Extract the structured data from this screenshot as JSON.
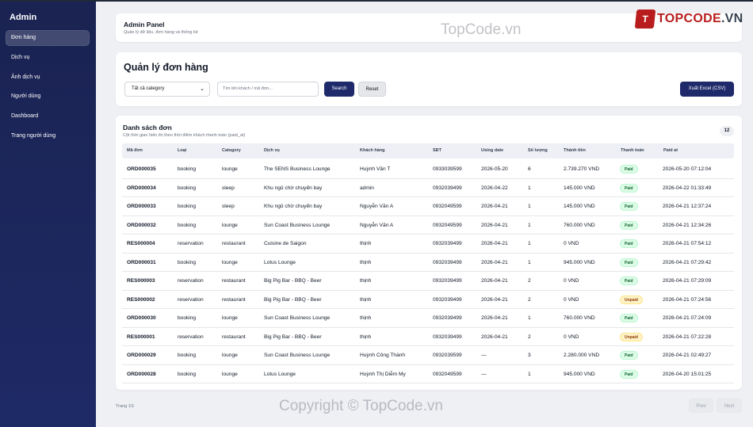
{
  "sidebar": {
    "brand": "Admin",
    "items": [
      {
        "label": "Đơn hàng",
        "active": true
      },
      {
        "label": "Dịch vụ"
      },
      {
        "label": "Ảnh dịch vụ"
      },
      {
        "label": "Người dùng"
      },
      {
        "label": "Dashboard"
      },
      {
        "label": "Trang người dùng"
      }
    ]
  },
  "header": {
    "title": "Admin Panel",
    "subtitle": "Quản lý dữ liệu, đơn hàng và thống kê",
    "logo_mark": "T",
    "logo_text_red": "TOPCODE",
    "logo_text_gray": ".VN"
  },
  "watermarks": {
    "top": "TopCode.vn",
    "bottom": "Copyright © TopCode.vn"
  },
  "filters": {
    "title": "Quản lý đơn hàng",
    "category_selected": "Tất cả category",
    "search_placeholder": "Tìm tên khách / mã đơn...",
    "search_label": "Search",
    "reset_label": "Reset",
    "export_label": "Xuất Excel (CSV)"
  },
  "list": {
    "title": "Danh sách đơn",
    "subtitle": "Cột thời gian hiển thị theo thời điểm khách thanh toán (paid_at)",
    "count": "12",
    "columns": [
      "Mã đơn",
      "Loại",
      "Category",
      "Dịch vụ",
      "Khách hàng",
      "SĐT",
      "Using date",
      "Số lượng",
      "Thành tiền",
      "Thanh toán",
      "Paid at"
    ],
    "rows": [
      {
        "id": "ORD000035",
        "type": "booking",
        "cat": "lounge",
        "svc": "The SENS Business Lounge",
        "cust": "Huỳnh Văn T",
        "phone": "0933039599",
        "date": "2026-05-20",
        "qty": "6",
        "total": "2.739.270 VND",
        "status": "Paid",
        "paid_at": "2026-05-20 07:12:04"
      },
      {
        "id": "ORD000034",
        "type": "booking",
        "cat": "sleep",
        "svc": "Khu ngủ chờ chuyến bay",
        "cust": "admin",
        "phone": "0932039499",
        "date": "2026-04-22",
        "qty": "1",
        "total": "145.000 VND",
        "status": "Paid",
        "paid_at": "2026-04-22 01:33:49"
      },
      {
        "id": "ORD000033",
        "type": "booking",
        "cat": "sleep",
        "svc": "Khu ngủ chờ chuyến bay",
        "cust": "Nguyễn Văn A",
        "phone": "0932049599",
        "date": "2026-04-21",
        "qty": "1",
        "total": "145.000 VND",
        "status": "Paid",
        "paid_at": "2026-04-21 12:37:24"
      },
      {
        "id": "ORD000032",
        "type": "booking",
        "cat": "lounge",
        "svc": "Sun Coast Business Lounge",
        "cust": "Nguyễn Văn A",
        "phone": "0932049599",
        "date": "2026-04-21",
        "qty": "1",
        "total": "760.000 VND",
        "status": "Paid",
        "paid_at": "2026-04-21 12:34:26"
      },
      {
        "id": "RES000004",
        "type": "reservation",
        "cat": "restaurant",
        "svc": "Cuisine de Saigon",
        "cust": "thịnh",
        "phone": "0932039499",
        "date": "2026-04-21",
        "qty": "1",
        "total": "0 VND",
        "status": "Paid",
        "paid_at": "2026-04-21 07:54:12"
      },
      {
        "id": "ORD000031",
        "type": "booking",
        "cat": "lounge",
        "svc": "Lotus Lounge",
        "cust": "thịnh",
        "phone": "0932039499",
        "date": "2026-04-21",
        "qty": "1",
        "total": "945.000 VND",
        "status": "Paid",
        "paid_at": "2026-04-21 07:29:42"
      },
      {
        "id": "RES000003",
        "type": "reservation",
        "cat": "restaurant",
        "svc": "Big Pig Bar - BBQ - Beer",
        "cust": "thịnh",
        "phone": "0932039499",
        "date": "2026-04-21",
        "qty": "2",
        "total": "0 VND",
        "status": "Paid",
        "paid_at": "2026-04-21 07:29:09"
      },
      {
        "id": "RES000002",
        "type": "reservation",
        "cat": "restaurant",
        "svc": "Big Pig Bar - BBQ - Beer",
        "cust": "thịnh",
        "phone": "0932039499",
        "date": "2026-04-21",
        "qty": "2",
        "total": "0 VND",
        "status": "Unpaid",
        "paid_at": "2026-04-21 07:24:56"
      },
      {
        "id": "ORD000030",
        "type": "booking",
        "cat": "lounge",
        "svc": "Sun Coast Business Lounge",
        "cust": "thịnh",
        "phone": "0932039499",
        "date": "2026-04-21",
        "qty": "1",
        "total": "760.000 VND",
        "status": "Paid",
        "paid_at": "2026-04-21 07:24:09"
      },
      {
        "id": "RES000001",
        "type": "reservation",
        "cat": "restaurant",
        "svc": "Big Pig Bar - BBQ - Beer",
        "cust": "thịnh",
        "phone": "0932039499",
        "date": "2026-04-21",
        "qty": "2",
        "total": "0 VND",
        "status": "Unpaid",
        "paid_at": "2026-04-21 07:22:28"
      },
      {
        "id": "ORD000029",
        "type": "booking",
        "cat": "lounge",
        "svc": "Sun Coast Business Lounge",
        "cust": "Huỳnh Công Thành",
        "phone": "0932039599",
        "date": "—",
        "qty": "3",
        "total": "2.280.000 VND",
        "status": "Paid",
        "paid_at": "2026-04-21 02:49:27"
      },
      {
        "id": "ORD000028",
        "type": "booking",
        "cat": "lounge",
        "svc": "Lotus Lounge",
        "cust": "Huỳnh Thị Diễm My",
        "phone": "0932049599",
        "date": "—",
        "qty": "1",
        "total": "945.000 VND",
        "status": "Paid",
        "paid_at": "2026-04-20 15:01:25"
      }
    ]
  },
  "pagination": {
    "info": "Trang 1/1",
    "prev": "Prev",
    "next": "Next"
  }
}
